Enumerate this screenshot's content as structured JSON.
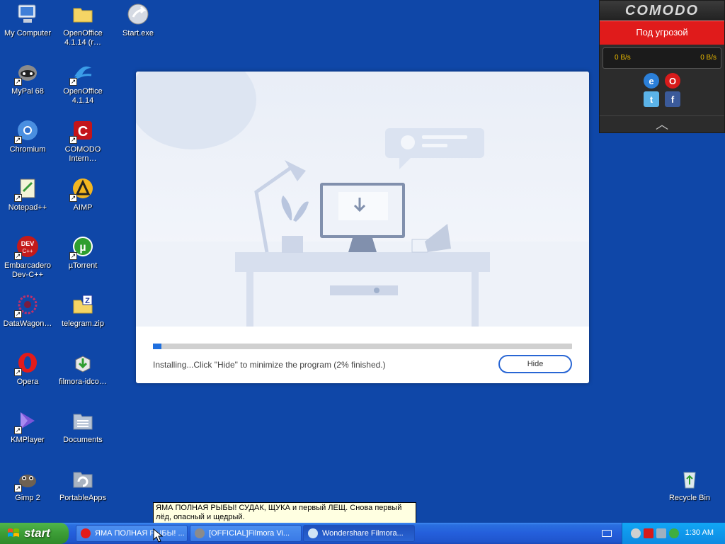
{
  "desktop": {
    "icons": [
      {
        "label": "My Computer",
        "icon": "computer-icon"
      },
      {
        "label": "OpenOffice\n4.1.14 (r…",
        "icon": "folder-icon"
      },
      {
        "label": "Start.exe",
        "icon": "globe-arrow-icon"
      },
      {
        "label": "MyPal 68",
        "icon": "raccoon-icon"
      },
      {
        "label": "OpenOffice\n4.1.14",
        "icon": "openoffice-icon"
      },
      {
        "label": "Chromium",
        "icon": "chromium-icon"
      },
      {
        "label": "COMODO\nIntern…",
        "icon": "comodo-icon"
      },
      {
        "label": "Notepad++",
        "icon": "notepad-icon"
      },
      {
        "label": "AIMP",
        "icon": "aimp-icon"
      },
      {
        "label": "Embarcadero\nDev-C++",
        "icon": "devcpp-icon"
      },
      {
        "label": "µTorrent",
        "icon": "utorrent-icon"
      },
      {
        "label": "DataWagon…",
        "icon": "datawagon-icon"
      },
      {
        "label": "telegram.zip",
        "icon": "zip-folder-icon"
      },
      {
        "label": "Opera",
        "icon": "opera-icon"
      },
      {
        "label": "filmora-idco…",
        "icon": "installer-box-icon"
      },
      {
        "label": "KMPlayer",
        "icon": "kmplayer-icon"
      },
      {
        "label": "Documents",
        "icon": "documents-folder-icon"
      },
      {
        "label": "Gimp 2",
        "icon": "gimp-icon"
      },
      {
        "label": "PortableApps",
        "icon": "portableapps-icon"
      },
      {
        "label": "Recycle Bin",
        "icon": "recycle-bin-icon"
      }
    ]
  },
  "installer": {
    "progress_percent": 2,
    "status_text": "Installing...Click \"Hide\" to minimize the program (2% finished.)",
    "hide_label": "Hide",
    "accent_color": "#1f6fde"
  },
  "comodo": {
    "logo": "COMODO",
    "status": "Под угрозой",
    "traffic_in": "0 B/s",
    "traffic_out": "0 B/s",
    "status_color": "#e01b1b"
  },
  "tooltip": {
    "text": "ЯМА ПОЛНАЯ РЫБЫ! СУДАК, ЩУКА и первый ЛЕЩ. Снова первый лёд, опасный и щедрый."
  },
  "taskbar": {
    "start_label": "start",
    "tasks": [
      {
        "label": "ЯМА ПОЛНАЯ РЫБЫ! ...",
        "icon": "opera-icon"
      },
      {
        "label": "[OFFICIAL]Filmora Vi...",
        "icon": "raccoon-icon"
      },
      {
        "label": "Wondershare Filmora...",
        "icon": "filmora-icon"
      }
    ],
    "clock": "1:30 AM"
  }
}
